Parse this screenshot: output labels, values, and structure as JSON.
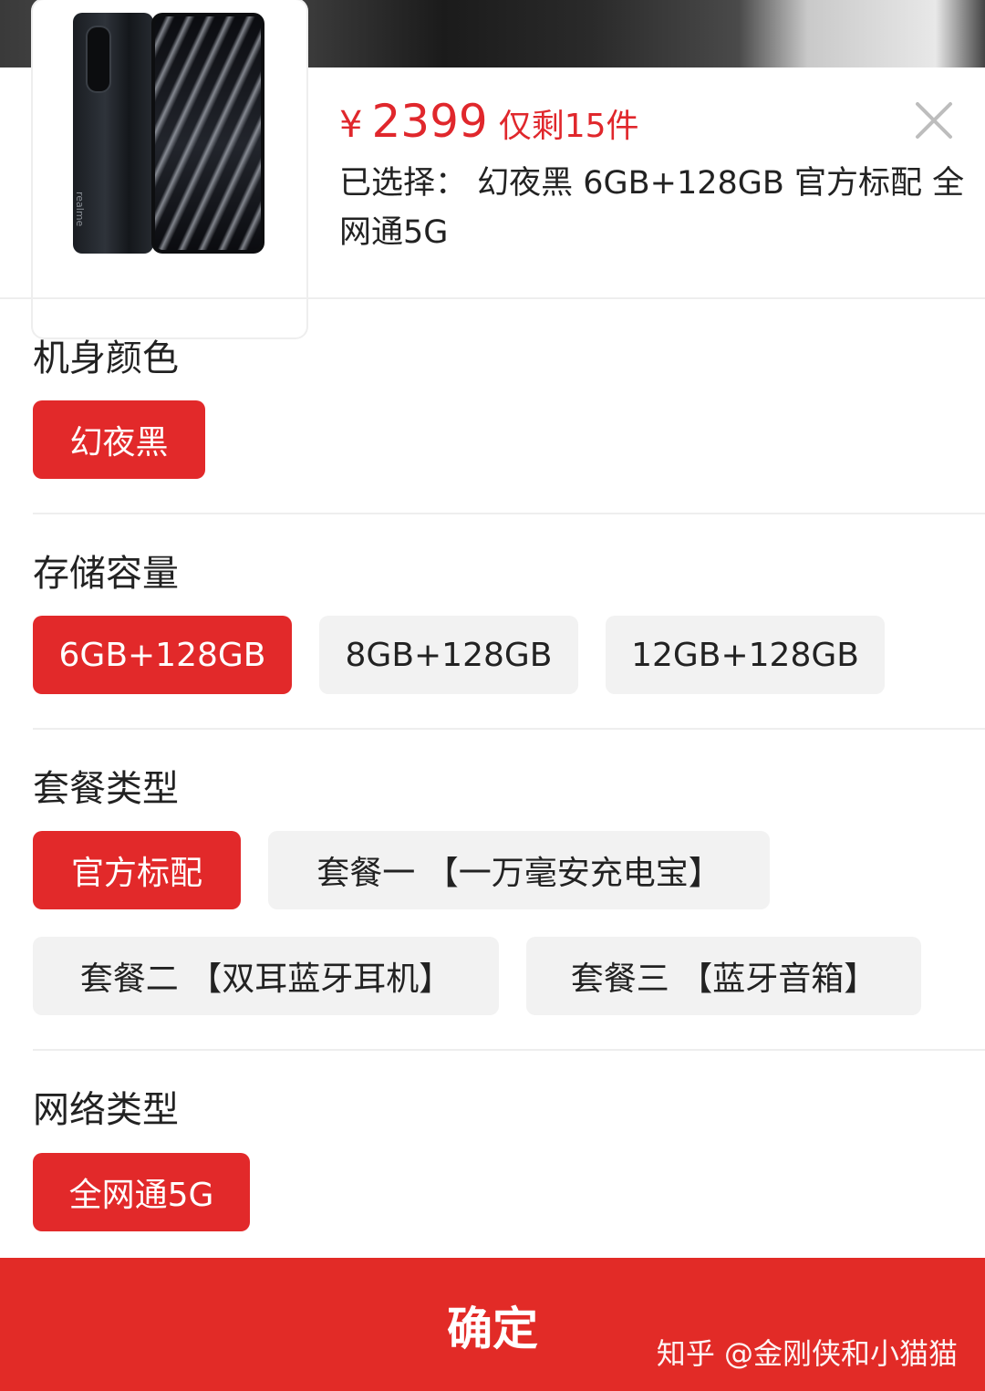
{
  "product": {
    "currency_symbol": "¥",
    "price": "2399",
    "stock_text": "仅剩15件",
    "selected_line": "已选择： 幻夜黑 6GB+128GB 官方标配 全网通5G",
    "phone_brand": "realme"
  },
  "sections": {
    "color": {
      "title": "机身颜色",
      "options": [
        "幻夜黑"
      ]
    },
    "storage": {
      "title": "存储容量",
      "options": [
        "6GB+128GB",
        "8GB+128GB",
        "12GB+128GB"
      ]
    },
    "package": {
      "title": "套餐类型",
      "options": [
        "官方标配",
        "套餐一 【一万毫安充电宝】",
        "套餐二 【双耳蓝牙耳机】",
        "套餐三 【蓝牙音箱】"
      ]
    },
    "network": {
      "title": "网络类型",
      "options": [
        "全网通5G"
      ]
    }
  },
  "confirm": {
    "label": "确定",
    "watermark": "知乎 @金刚侠和小猫猫"
  },
  "colors": {
    "accent": "#e2292a",
    "unselected_bg": "#f2f2f2",
    "price_red": "#e0272c"
  }
}
